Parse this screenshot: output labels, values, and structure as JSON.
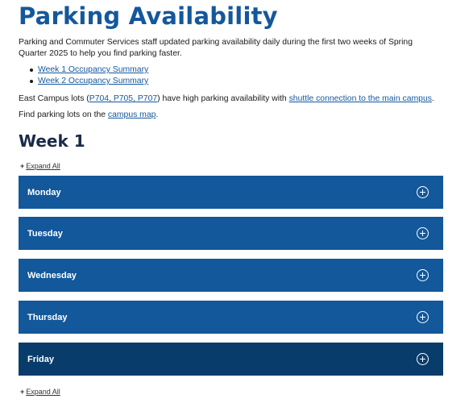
{
  "page_title": "Parking Availability",
  "intro": "Parking and Commuter Services staff updated parking availability daily during the first two weeks of Spring Quarter 2025 to help you find parking faster.",
  "summary_links": [
    "Week 1 Occupancy Summary",
    "Week 2 Occupancy Summary"
  ],
  "east_campus": {
    "prefix": "East Campus lots (",
    "lots_link": "P704, P705, P707",
    "middle": ") have high parking availability with ",
    "shuttle_link": "shuttle connection to the main campus",
    "suffix": "."
  },
  "campus_map": {
    "prefix": "Find parking lots on the ",
    "link": "campus map",
    "suffix": "."
  },
  "week_heading": "Week 1",
  "expand_all": {
    "plus": "+",
    "label": "Expand All"
  },
  "days": [
    "Monday",
    "Tuesday",
    "Wednesday",
    "Thursday",
    "Friday"
  ],
  "colors": {
    "title": "#14589c",
    "accordion": "#12589a",
    "accordion_active": "#083d6b",
    "heading": "#1b2a48"
  }
}
